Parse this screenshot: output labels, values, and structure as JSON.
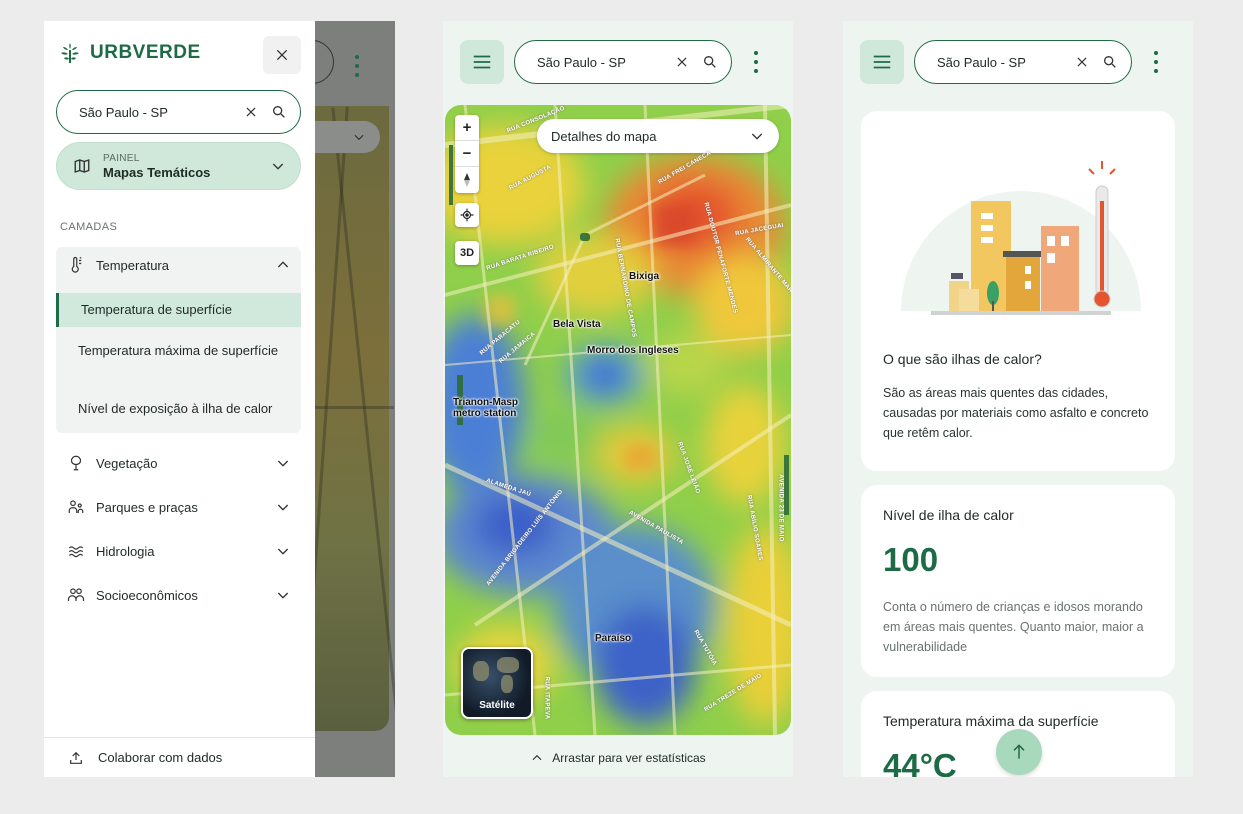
{
  "colors": {
    "brand": "#1d6b46",
    "accent_light": "#cfe8d9",
    "heat_hot": "#e4552e",
    "heat_cool": "#3b63d6"
  },
  "panel1": {
    "brand_name": "URBVERDE",
    "search": {
      "value": "São Paulo - SP"
    },
    "painel": {
      "label": "PAINEL",
      "value": "Mapas Temáticos"
    },
    "section_label": "CAMADAS",
    "layers": [
      {
        "label": "Temperatura",
        "icon": "thermometer-icon",
        "expanded": true
      },
      {
        "label": "Vegetação",
        "icon": "tree-icon"
      },
      {
        "label": "Parques e praças",
        "icon": "people-icon"
      },
      {
        "label": "Hidrologia",
        "icon": "waves-icon"
      },
      {
        "label": "Socioeconômicos",
        "icon": "group-icon"
      }
    ],
    "temp_sublayers": [
      {
        "label": "Temperatura de superfície",
        "active": true
      },
      {
        "label": "Temperatura máxima de superfície"
      },
      {
        "label": "Nível de exposição à ilha de calor"
      }
    ],
    "collab": "Colaborar com dados"
  },
  "panel2": {
    "search": {
      "value": "São Paulo - SP"
    },
    "detalhes": "Detalhes do mapa",
    "zoom_in": "+",
    "zoom_out": "−",
    "btn_3d": "3D",
    "places": [
      "Bixiga",
      "Bela Vista",
      "Morro dos Ingleses",
      "Trianon-Masp",
      "metro station",
      "Paraíso"
    ],
    "streets": [
      "RUA CONSOLAÇÃO",
      "RUA AUGUSTA",
      "RUA FREI CANECA",
      "RUA BARATA RIBEIRO",
      "RUA DOUTOR PENAFORTE MENDES",
      "RUA JACEGUAI",
      "RUA ALMIRANTE MARQUES LEÃO",
      "AVENIDA 23 DE MAIO",
      "ALAMEDA JAÚ",
      "AVENIDA PAULISTA",
      "AVENIDA BRIGADEIRO LUÍS ANTÔNIO",
      "RUA ABÍLIO SOARES",
      "RUA JOSÉ LEIÃO",
      "RUA BERNARDINO DE CAMPOS",
      "RUA TUTÓIA",
      "RUA PARACATU",
      "RUA JAMAICA",
      "RUA TREZE DE MAIO",
      "RUA ITAPEVA"
    ],
    "satelite": "Satélite",
    "drag": "Arrastar para ver estatísticas"
  },
  "panel3": {
    "search": {
      "value": "São Paulo - SP"
    },
    "card1": {
      "title": "O que são ilhas de calor?",
      "body": "São as áreas mais quentes das cidades, causadas por materiais como asfalto e concreto que retêm calor."
    },
    "card2": {
      "title": "Nível de ilha de calor",
      "value": "100",
      "body": "Conta o número de crianças e idosos morando em áreas mais quentes. Quanto maior, maior a vulnerabilidade"
    },
    "card3": {
      "title": "Temperatura máxima da superfície",
      "value": "44°C"
    }
  }
}
